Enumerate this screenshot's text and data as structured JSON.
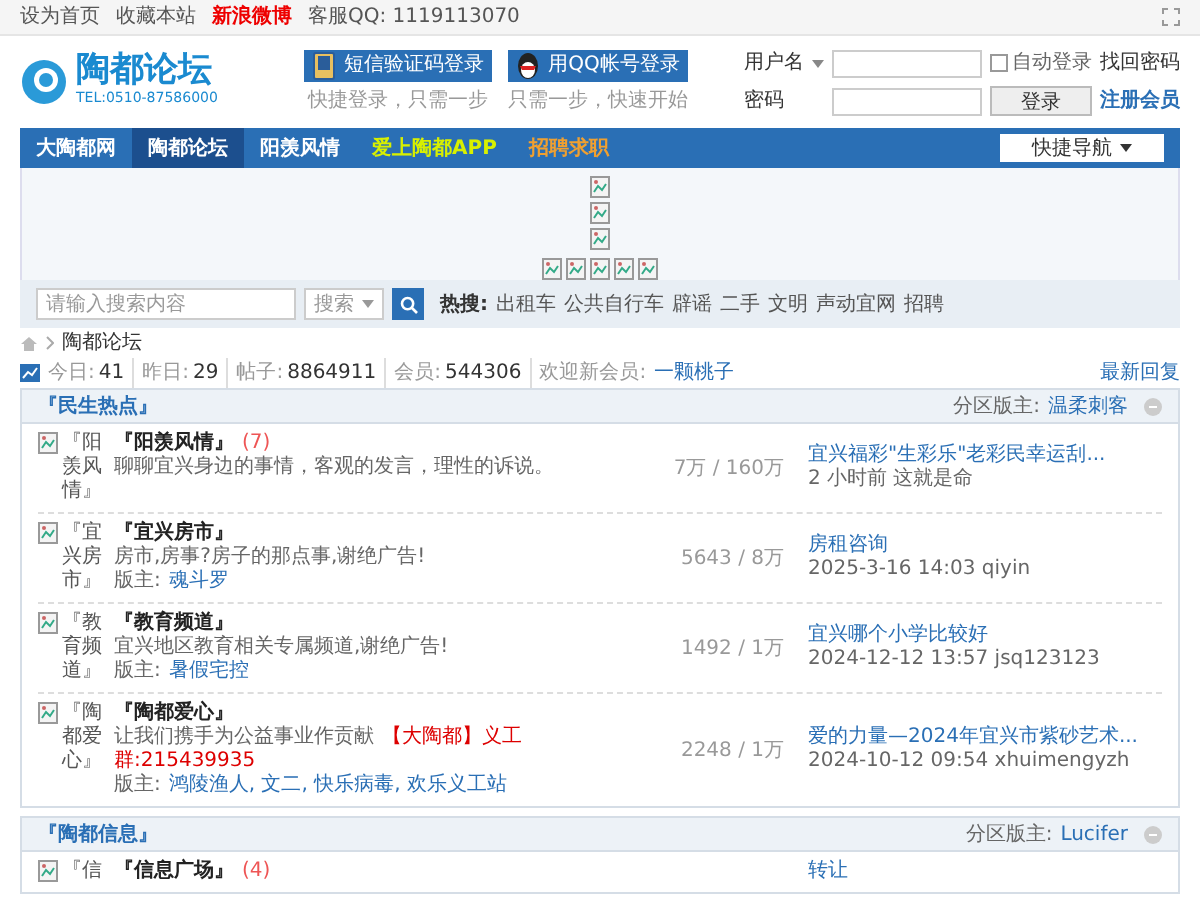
{
  "top_bar": {
    "links": [
      {
        "label": "设为首页",
        "highlight": false
      },
      {
        "label": "收藏本站",
        "highlight": false
      },
      {
        "label": "新浪微博",
        "highlight": true
      },
      {
        "label": "客服QQ: 1119113070",
        "highlight": false
      }
    ]
  },
  "header": {
    "logo": "陶都论坛",
    "phone": "TEL:0510-87586000",
    "login_options": [
      {
        "label": "短信验证码登录",
        "hint": "快捷登录，只需一步",
        "kind": "sms"
      },
      {
        "label": "用QQ帐号登录",
        "hint": "只需一步，快速开始",
        "kind": "qq"
      }
    ],
    "login_form": {
      "username_label": "用户名",
      "password_label": "密码",
      "auto_login": {
        "label": "自动登录",
        "checked": false
      },
      "forgot": "找回密码",
      "submit": "登录",
      "register": "注册会员"
    }
  },
  "nav": {
    "items": [
      {
        "label": "大陶都网",
        "selected": false,
        "kind": "normal"
      },
      {
        "label": "陶都论坛",
        "selected": true,
        "kind": "normal"
      },
      {
        "label": "阳羡风情",
        "selected": false,
        "kind": "normal"
      },
      {
        "label": "爱上陶都APP",
        "selected": false,
        "kind": "app"
      },
      {
        "label": "招聘求职",
        "selected": false,
        "kind": "jobs"
      }
    ],
    "quick_nav": "快捷导航"
  },
  "search": {
    "placeholder": "请输入搜索内容",
    "scope": "搜索",
    "hot_label": "热搜:",
    "hot": [
      "出租车",
      "公共自行车",
      "辟谣",
      "二手",
      "文明",
      "声动宜网",
      "招聘"
    ]
  },
  "breadcrumb": [
    "陶都论坛"
  ],
  "stats": {
    "items": [
      {
        "label": "今日:",
        "value": "41"
      },
      {
        "label": "昨日:",
        "value": "29"
      },
      {
        "label": "帖子:",
        "value": "8864911"
      },
      {
        "label": "会员:",
        "value": "544306"
      }
    ],
    "welcome_label": "欢迎新会员:",
    "welcome_user": "一颗桃子",
    "latest": "最新回复"
  },
  "categories": [
    {
      "title": "『民生热点』",
      "moderator_label": "分区版主:",
      "moderator": "温柔刺客",
      "forums": [
        {
          "icon_alt": "『阳羡风情』",
          "name": "『阳羡风情』",
          "new_count": "(7)",
          "description": "聊聊宜兴身边的事情，客观的发言，理性的诉说。",
          "counts": "7万 / 160万",
          "last_title": "宜兴福彩\"生彩乐\"老彩民幸运刮...",
          "last_meta": "2 小时前 这就是命"
        },
        {
          "icon_alt": "『宜兴房市』",
          "name": "『宜兴房市』",
          "description": "房市,房事?房子的那点事,谢绝广告!",
          "moderators_label": "版主:",
          "moderators": "魂斗罗",
          "counts": "5643 / 8万",
          "last_title": "房租咨询",
          "last_meta": "2025-3-16 14:03 qiyin"
        },
        {
          "icon_alt": "『教育频道』",
          "name": "『教育频道』",
          "description": "宜兴地区教育相关专属频道,谢绝广告!",
          "moderators_label": "版主:",
          "moderators": "暑假宅控",
          "counts": "1492 / 1万",
          "last_title": "宜兴哪个小学比较好",
          "last_meta": "2024-12-12 13:57 jsq123123"
        },
        {
          "icon_alt": "『陶都爱心』",
          "name": "『陶都爱心』",
          "description": "让我们携手为公益事业作贡献",
          "description_highlight": "【大陶都】义工群:215439935",
          "moderators_label": "版主:",
          "moderators": "鸿陵渔人, 文二, 快乐病毒, 欢乐义工站",
          "counts": "2248 / 1万",
          "last_title": "爱的力量—2024年宜兴市紫砂艺术...",
          "last_meta": "2024-10-12 09:54 xhuimengyzh"
        }
      ]
    },
    {
      "title": "『陶都信息』",
      "moderator_label": "分区版主:",
      "moderator": "Lucifer",
      "forums": [
        {
          "icon_alt": "『信",
          "name": "『信息广场』",
          "new_count": "(4)",
          "last_title": "转让"
        }
      ]
    }
  ]
}
